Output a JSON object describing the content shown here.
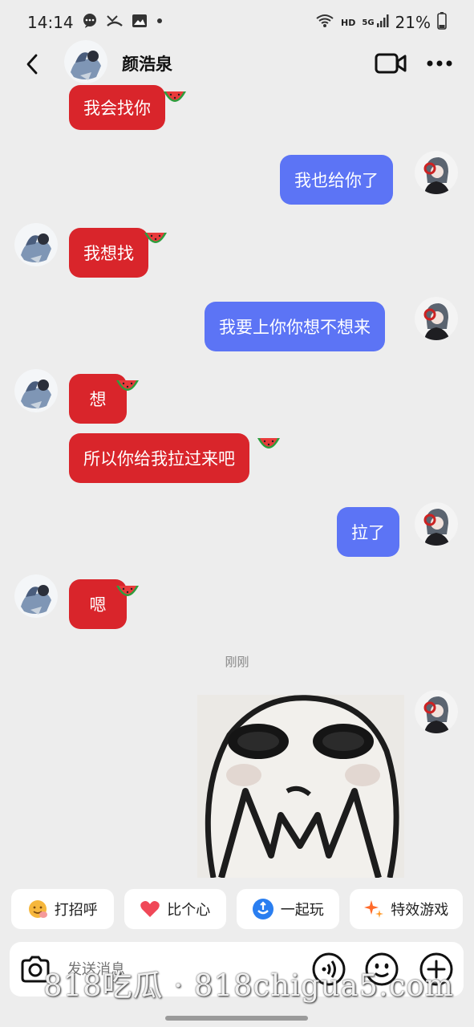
{
  "status": {
    "time": "14:14",
    "battery": "21%",
    "network": "HD",
    "signal": "5G"
  },
  "header": {
    "contact_name": "颜浩泉"
  },
  "messages": [
    {
      "side": "left",
      "text": "我会找你",
      "color": "#d9252b"
    },
    {
      "side": "right",
      "text": "我也给你了",
      "color": "#5c74f5"
    },
    {
      "side": "left",
      "text": "我想找",
      "color": "#d9252b"
    },
    {
      "side": "right",
      "text": "我要上你你想不想来",
      "color": "#5c74f5"
    },
    {
      "side": "left",
      "text": "想",
      "color": "#d9252b"
    },
    {
      "side": "left",
      "text": "所以你给我拉过来吧",
      "color": "#d9252b"
    },
    {
      "side": "right",
      "text": "拉了",
      "color": "#5c74f5"
    },
    {
      "side": "left",
      "text": "嗯",
      "color": "#d9252b"
    }
  ],
  "timestamp": "刚刚",
  "quick_actions": [
    {
      "label": "打招呼",
      "icon": "wave-emoji-icon"
    },
    {
      "label": "比个心",
      "icon": "heart-icon"
    },
    {
      "label": "一起玩",
      "icon": "play-together-icon"
    },
    {
      "label": "特效游戏",
      "icon": "sparkle-icon"
    }
  ],
  "input": {
    "placeholder": "发送消息"
  },
  "watermark": "818吃瓜 · 818chigua5.com"
}
